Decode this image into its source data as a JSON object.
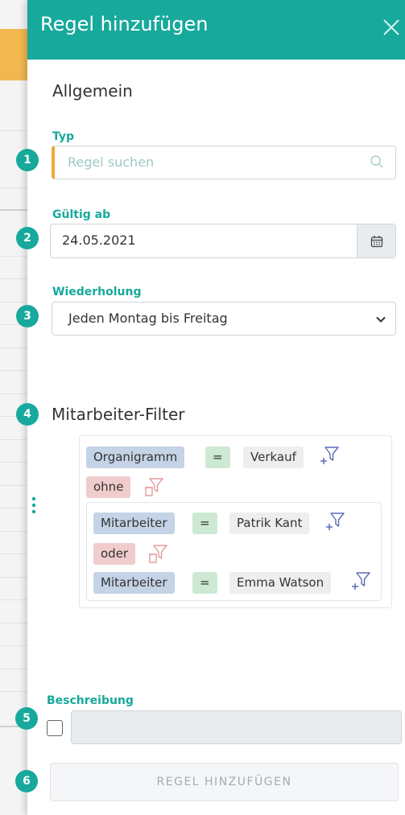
{
  "header": {
    "title": "Regel hinzufügen",
    "close_icon": "close-icon"
  },
  "general": {
    "section_title": "Allgemein",
    "type": {
      "label": "Typ",
      "placeholder": "Regel suchen",
      "badge": "1"
    },
    "valid_from": {
      "label": "Gültig ab",
      "value": "24.05.2021",
      "badge": "2"
    },
    "repeat": {
      "label": "Wiederholung",
      "value": "Jeden Montag bis Freitag",
      "badge": "3"
    }
  },
  "employee_filter": {
    "section_title": "Mitarbeiter-Filter",
    "badge": "4",
    "outer_rule": {
      "field": "Organigramm",
      "op": "=",
      "value": "Verkauf"
    },
    "outer_connector": "ohne",
    "inner_rule_1": {
      "field": "Mitarbeiter",
      "op": "=",
      "value": "Patrik Kant"
    },
    "inner_connector": "oder",
    "inner_rule_2": {
      "field": "Mitarbeiter",
      "op": "=",
      "value": "Emma Watson"
    }
  },
  "description": {
    "label": "Beschreibung",
    "badge": "5"
  },
  "submit": {
    "label": "REGEL HINZUFÜGEN",
    "badge": "6"
  },
  "colors": {
    "accent": "#17a99c",
    "highlight": "#f0a83c",
    "chip_blue": "#c4d3e6",
    "chip_green": "#cde9d3",
    "chip_red": "#f0cccc"
  }
}
